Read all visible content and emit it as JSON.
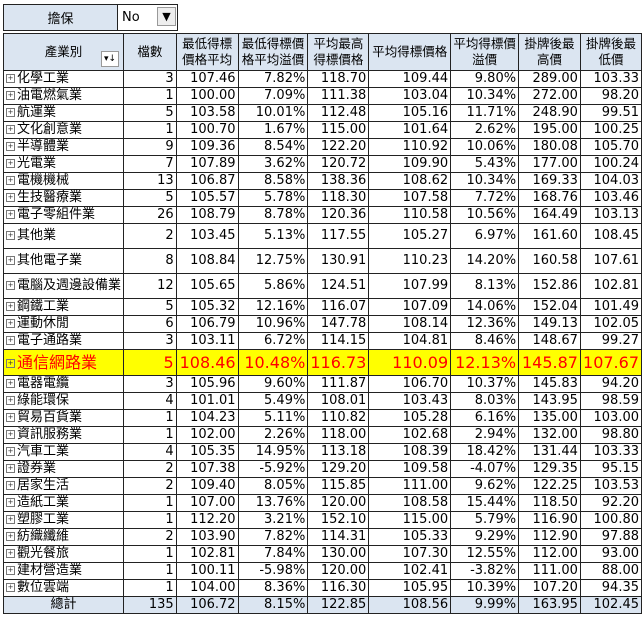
{
  "filter": {
    "label": "擔保",
    "value": "No"
  },
  "headers": [
    "產業別",
    "檔數",
    "最低得標價格平均",
    "最低得標價格平均溢價",
    "平均最高得標價格",
    "平均得標價格",
    "平均得標價溢價",
    "掛牌後最高價",
    "掛牌後最低價"
  ],
  "header_lines": [
    [
      "產業別"
    ],
    [
      "檔數"
    ],
    [
      "最低得標",
      "價格平均"
    ],
    [
      "最低得標價",
      "格平均溢價"
    ],
    [
      "平均最高",
      "得標價格"
    ],
    [
      "平均得標價格"
    ],
    [
      "平均得標價",
      "溢價"
    ],
    [
      "掛牌後最",
      "高價"
    ],
    [
      "掛牌後最",
      "低價"
    ]
  ],
  "rows": [
    [
      "化學工業",
      "3",
      "107.46",
      "7.82%",
      "118.70",
      "109.44",
      "9.80%",
      "289.00",
      "103.33"
    ],
    [
      "油電燃氣業",
      "1",
      "100.00",
      "7.09%",
      "111.38",
      "103.04",
      "10.34%",
      "272.00",
      "98.20"
    ],
    [
      "航運業",
      "5",
      "103.58",
      "10.01%",
      "112.48",
      "105.16",
      "11.71%",
      "248.90",
      "99.51"
    ],
    [
      "文化創意業",
      "1",
      "100.70",
      "1.67%",
      "115.00",
      "101.64",
      "2.62%",
      "195.00",
      "100.25"
    ],
    [
      "半導體業",
      "9",
      "109.36",
      "8.54%",
      "122.20",
      "110.92",
      "10.06%",
      "180.08",
      "105.70"
    ],
    [
      "光電業",
      "7",
      "107.89",
      "3.62%",
      "120.72",
      "109.90",
      "5.43%",
      "177.00",
      "100.24"
    ],
    [
      "電機機械",
      "13",
      "106.87",
      "8.58%",
      "138.36",
      "108.62",
      "10.34%",
      "169.33",
      "104.03"
    ],
    [
      "生技醫療業",
      "5",
      "105.57",
      "5.78%",
      "118.30",
      "107.58",
      "7.72%",
      "168.76",
      "103.46"
    ],
    [
      "電子零組件業",
      "26",
      "108.79",
      "8.78%",
      "120.36",
      "110.58",
      "10.56%",
      "164.49",
      "103.13"
    ],
    [
      "其他業",
      "2",
      "103.45",
      "5.13%",
      "117.55",
      "105.27",
      "6.97%",
      "161.60",
      "108.45"
    ],
    [
      "其他電子業",
      "8",
      "108.84",
      "12.75%",
      "130.91",
      "110.23",
      "14.20%",
      "160.58",
      "107.61"
    ],
    [
      "電腦及週邊設備業",
      "12",
      "105.65",
      "5.86%",
      "124.51",
      "107.99",
      "8.13%",
      "152.86",
      "102.81"
    ],
    [
      "鋼鐵工業",
      "5",
      "105.32",
      "12.16%",
      "116.07",
      "107.09",
      "14.06%",
      "152.04",
      "101.49"
    ],
    [
      "運動休閒",
      "6",
      "106.79",
      "10.96%",
      "147.78",
      "108.14",
      "12.36%",
      "149.13",
      "102.05"
    ],
    [
      "電子通路業",
      "3",
      "103.11",
      "6.72%",
      "114.15",
      "104.81",
      "8.46%",
      "148.67",
      "99.27"
    ],
    [
      "通信網路業",
      "5",
      "108.46",
      "10.48%",
      "116.73",
      "110.09",
      "12.13%",
      "145.87",
      "107.67"
    ],
    [
      "電器電纜",
      "3",
      "105.96",
      "9.60%",
      "111.87",
      "106.70",
      "10.37%",
      "145.83",
      "94.20"
    ],
    [
      "綠能環保",
      "4",
      "101.01",
      "5.49%",
      "108.01",
      "103.43",
      "8.03%",
      "143.95",
      "98.59"
    ],
    [
      "貿易百貨業",
      "1",
      "104.23",
      "5.11%",
      "110.82",
      "105.28",
      "6.16%",
      "135.00",
      "103.00"
    ],
    [
      "資訊服務業",
      "1",
      "102.00",
      "2.26%",
      "118.00",
      "102.68",
      "2.94%",
      "132.00",
      "98.80"
    ],
    [
      "汽車工業",
      "4",
      "105.35",
      "14.95%",
      "113.18",
      "108.39",
      "18.42%",
      "131.44",
      "103.33"
    ],
    [
      "證券業",
      "2",
      "107.38",
      "-5.92%",
      "129.20",
      "109.58",
      "-4.07%",
      "129.35",
      "95.15"
    ],
    [
      "居家生活",
      "2",
      "109.40",
      "8.05%",
      "115.85",
      "111.00",
      "9.62%",
      "122.25",
      "103.53"
    ],
    [
      "造紙工業",
      "1",
      "107.00",
      "13.76%",
      "120.00",
      "108.58",
      "15.44%",
      "118.50",
      "92.20"
    ],
    [
      "塑膠工業",
      "1",
      "112.20",
      "3.21%",
      "152.10",
      "115.00",
      "5.79%",
      "116.90",
      "100.80"
    ],
    [
      "紡織纖維",
      "2",
      "103.90",
      "7.82%",
      "114.31",
      "105.33",
      "9.29%",
      "112.90",
      "97.88"
    ],
    [
      "觀光餐旅",
      "1",
      "102.81",
      "7.84%",
      "130.00",
      "107.30",
      "12.55%",
      "112.00",
      "93.00"
    ],
    [
      "建材營造業",
      "1",
      "100.11",
      "-5.98%",
      "120.00",
      "102.41",
      "-3.82%",
      "111.00",
      "88.00"
    ],
    [
      "數位雲端",
      "1",
      "104.00",
      "8.36%",
      "116.30",
      "105.95",
      "10.39%",
      "107.20",
      "94.35"
    ]
  ],
  "total": [
    "總計",
    "135",
    "106.72",
    "8.15%",
    "122.85",
    "108.56",
    "9.99%",
    "163.95",
    "102.45"
  ],
  "highlight_row": "通信網路業",
  "tall_rows": [
    "其他業",
    "其他電子業",
    "電腦及週邊設備業"
  ],
  "colors": {
    "header_bg": "#dbe5f1",
    "highlight_bg": "#ffff00",
    "highlight_text": "#ff0000"
  }
}
